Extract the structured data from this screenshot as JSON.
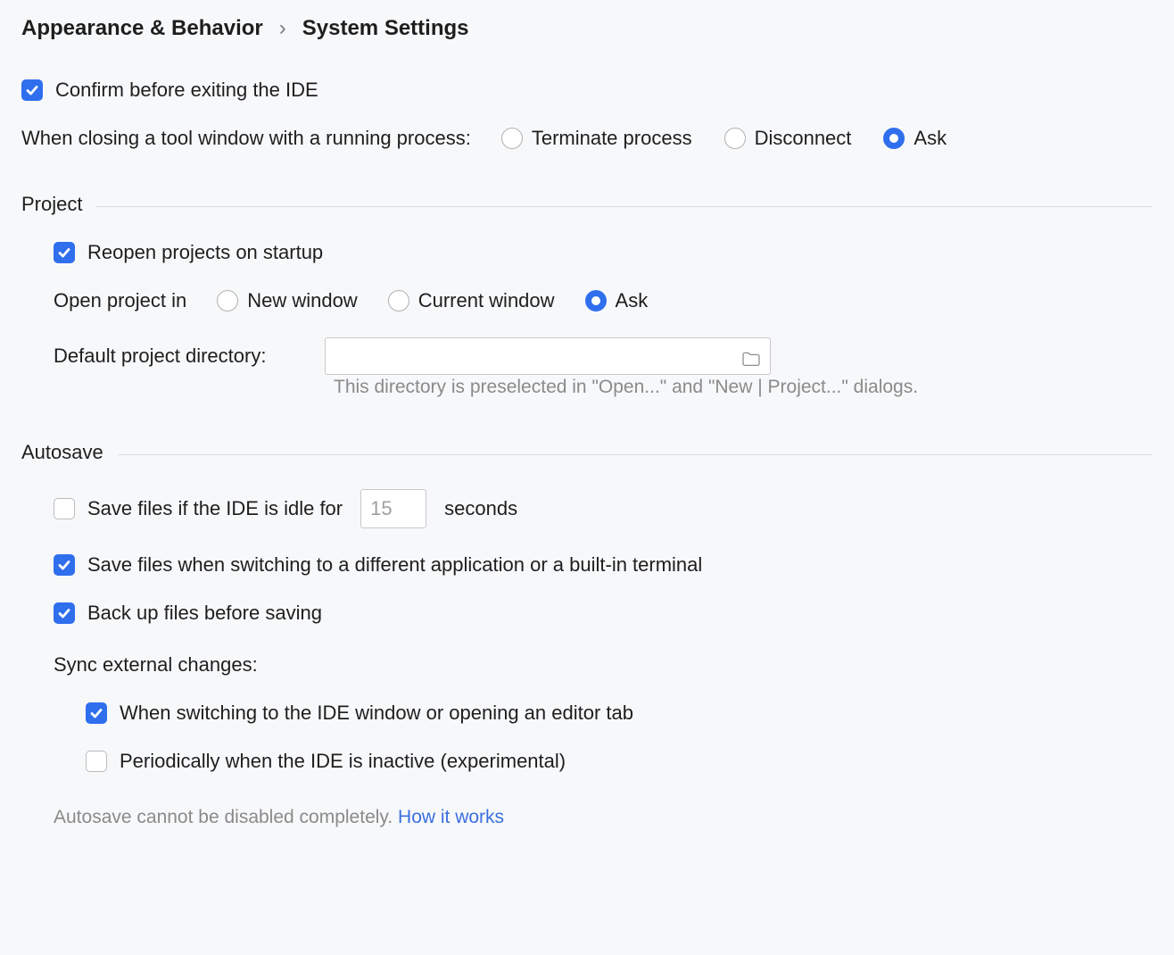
{
  "breadcrumb": {
    "parent": "Appearance & Behavior",
    "separator": "›",
    "current": "System Settings"
  },
  "general": {
    "confirm_exit_label": "Confirm before exiting the IDE",
    "confirm_exit_checked": true,
    "closing_tool_window_label": "When closing a tool window with a running process:",
    "closing_options": [
      {
        "label": "Terminate process",
        "selected": false
      },
      {
        "label": "Disconnect",
        "selected": false
      },
      {
        "label": "Ask",
        "selected": true
      }
    ]
  },
  "project": {
    "section_title": "Project",
    "reopen_label": "Reopen projects on startup",
    "reopen_checked": true,
    "open_in_label": "Open project in",
    "open_options": [
      {
        "label": "New window",
        "selected": false
      },
      {
        "label": "Current window",
        "selected": false
      },
      {
        "label": "Ask",
        "selected": true
      }
    ],
    "default_dir_label": "Default project directory:",
    "default_dir_value": "",
    "default_dir_hint": "This directory is preselected in \"Open...\" and \"New | Project...\" dialogs."
  },
  "autosave": {
    "section_title": "Autosave",
    "idle_prefix": "Save files if the IDE is idle for",
    "idle_value": "15",
    "idle_suffix": "seconds",
    "idle_checked": false,
    "switch_label": "Save files when switching to a different application or a built-in terminal",
    "switch_checked": true,
    "backup_label": "Back up files before saving",
    "backup_checked": true,
    "sync_header": "Sync external changes:",
    "sync_switch_label": "When switching to the IDE window or opening an editor tab",
    "sync_switch_checked": true,
    "sync_periodic_label": "Periodically when the IDE is inactive (experimental)",
    "sync_periodic_checked": false,
    "note_text": "Autosave cannot be disabled completely. ",
    "note_link": "How it works"
  }
}
